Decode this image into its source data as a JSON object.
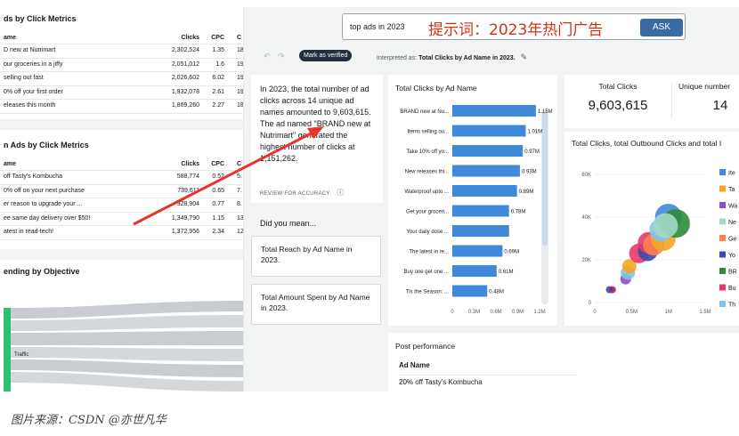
{
  "left_panel": {
    "table1": {
      "title": "ds by Click Metrics",
      "headers": [
        "ame",
        "Clicks",
        "CPC",
        "C"
      ],
      "rows": [
        [
          "D new at Nutrimart",
          "2,302,524",
          "1.35",
          "18."
        ],
        [
          "our groceries in a jiffy",
          "2,051,012",
          "1.6",
          "19."
        ],
        [
          " selling out fast",
          "2,026,602",
          "6.02",
          "19."
        ],
        [
          "0% off your first order",
          "1,932,078",
          "2.61",
          "19."
        ],
        [
          "eleases this month",
          "1,869,260",
          "2.27",
          "18."
        ]
      ]
    },
    "table2": {
      "title": "n Ads by Click Metrics",
      "headers": [
        "ame",
        "Clicks",
        "CPC",
        "C"
      ],
      "rows": [
        [
          "off Tasty's Kombucha",
          "588,774",
          "0.52",
          "5."
        ],
        [
          "0% off on your next purchase",
          "739,611",
          "0.65",
          "7."
        ],
        [
          "er reason to upgrade your ...",
          "928,904",
          "0.77",
          "8."
        ],
        [
          "ee same day delivery over $50!",
          "1,349,790",
          "1.15",
          "13."
        ],
        [
          "atest in read-tech!",
          "1,372,956",
          "2.34",
          "12."
        ]
      ]
    },
    "sankey": {
      "title": "ending by Objective",
      "node_label": "Traffic"
    }
  },
  "top": {
    "search_value": "top ads in 2023",
    "prompt_overlay": "提示词：2023年热门广告",
    "ask_label": "ASK",
    "mark_verified": "Mark as verified",
    "interpreted_prefix": "Interpreted as: ",
    "interpreted_value": "Total Clicks by Ad Name in 2023.",
    "undo_icon": "↶",
    "redo_icon": "↷",
    "edit_icon": "✎"
  },
  "answer": {
    "text": "In 2023, the total number of ad clicks across 14 unique ad names amounted to 9,603,615. The ad named \"BRAND new at Nutrimart\" generated the highest number of clicks at 1,151,262.",
    "review": "REVIEW FOR ACCURACY",
    "info_icon": "ⓘ",
    "did_you_mean": "Did you mean...",
    "suggestions": [
      "Total Reach by Ad Name in 2023.",
      "Total Amount Spent by Ad Name in 2023."
    ]
  },
  "bar_chart": {
    "title": "Total Clicks by Ad Name",
    "bar_color": "#3f8ad8",
    "chart_data": {
      "type": "bar",
      "orientation": "horizontal",
      "categories": [
        "BRAND new at Nu...",
        "Items selling ou...",
        "Take 10% off yo...",
        "New releases thi...",
        "Waterproof upto ...",
        "Get your groceri...",
        "Your daily dose ...",
        "The latest in re...",
        "Buy one get one ...",
        "Tis the Season: ..."
      ],
      "values": [
        1.15,
        1.01,
        0.97,
        0.93,
        0.89,
        0.78,
        0.78,
        0.69,
        0.61,
        0.48
      ],
      "data_labels": [
        "1.15M",
        "1.01M",
        "0.97M",
        "0.93M",
        "0.89M",
        "0.78M",
        "",
        "0.69M",
        "0.61M",
        "0.48M"
      ],
      "xticks": [
        "0",
        "0.3M",
        "0.6M",
        "0.9M",
        "1.2M"
      ],
      "xlim": [
        0,
        1.2
      ],
      "unit": "M"
    }
  },
  "kpis": [
    {
      "label": "Total Clicks",
      "value": "9,603,615"
    },
    {
      "label": "Unique number",
      "value": "14"
    }
  ],
  "scatter_chart": {
    "title": "Total Clicks, total Outbound Clicks and total I",
    "chart_data": {
      "type": "scatter",
      "yticks": [
        "60K",
        "40K",
        "20K",
        "0"
      ],
      "xticks": [
        "0",
        "0.5M",
        "1M",
        "1.5M"
      ],
      "xlim": [
        0,
        1.5
      ],
      "ylim": [
        0,
        60
      ],
      "points": [
        {
          "x": 0.2,
          "y": 6,
          "color": "#3b4ba8",
          "size": 4
        },
        {
          "x": 0.24,
          "y": 6,
          "color": "#8a2d7a",
          "size": 4
        },
        {
          "x": 0.42,
          "y": 11,
          "color": "#8a4fc8",
          "size": 6
        },
        {
          "x": 0.45,
          "y": 14,
          "color": "#7fc3e8",
          "size": 8
        },
        {
          "x": 0.47,
          "y": 17,
          "color": "#f5a623",
          "size": 8
        },
        {
          "x": 0.6,
          "y": 23,
          "color": "#e8386a",
          "size": 11
        },
        {
          "x": 0.72,
          "y": 24,
          "color": "#3b4ba8",
          "size": 11
        },
        {
          "x": 0.73,
          "y": 28,
          "color": "#e8386a",
          "size": 12
        },
        {
          "x": 0.8,
          "y": 27,
          "color": "#ff7f50",
          "size": 12
        },
        {
          "x": 0.93,
          "y": 30,
          "color": "#f5a623",
          "size": 14
        },
        {
          "x": 0.9,
          "y": 34,
          "color": "#7fc3e8",
          "size": 13
        },
        {
          "x": 1.0,
          "y": 40,
          "color": "#3f8ad8",
          "size": 15
        },
        {
          "x": 1.1,
          "y": 37,
          "color": "#2e8b3a",
          "size": 16
        },
        {
          "x": 0.96,
          "y": 36,
          "color": "#a3d9c8",
          "size": 14
        }
      ],
      "legend": [
        {
          "label": "Ite",
          "color": "#3f8ad8"
        },
        {
          "label": "Ta",
          "color": "#f5a623"
        },
        {
          "label": "Wa",
          "color": "#8a4fc8"
        },
        {
          "label": "Ne",
          "color": "#a3d9c8"
        },
        {
          "label": "Ge",
          "color": "#ff7f50"
        },
        {
          "label": "Yo",
          "color": "#3b4ba8"
        },
        {
          "label": "BR",
          "color": "#2e8b3a"
        },
        {
          "label": "Bu",
          "color": "#e8386a"
        },
        {
          "label": "Th",
          "color": "#7fc3e8"
        }
      ],
      "legend_position": "right"
    }
  },
  "post_performance": {
    "title": "Post performance",
    "column": "Ad Name",
    "first_row": "20% off Tasty's Kombucha"
  },
  "caption": "图片来源：CSDN @亦世凡华",
  "annotation_arrow_color": "#e8352a"
}
